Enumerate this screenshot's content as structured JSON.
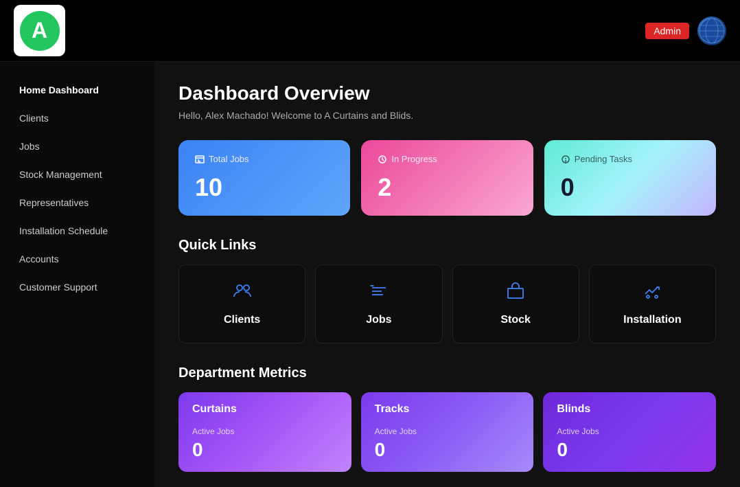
{
  "header": {
    "logo_letter": "A",
    "admin_label": "Admin"
  },
  "sidebar": {
    "items": [
      {
        "id": "home-dashboard",
        "label": "Home Dashboard",
        "active": true
      },
      {
        "id": "clients",
        "label": "Clients",
        "active": false
      },
      {
        "id": "jobs",
        "label": "Jobs",
        "active": false
      },
      {
        "id": "stock-management",
        "label": "Stock Management",
        "active": false
      },
      {
        "id": "representatives",
        "label": "Representatives",
        "active": false
      },
      {
        "id": "installation-schedule",
        "label": "Installation Schedule",
        "active": false
      },
      {
        "id": "accounts",
        "label": "Accounts",
        "active": false
      },
      {
        "id": "customer-support",
        "label": "Customer Support",
        "active": false
      }
    ]
  },
  "content": {
    "page_title": "Dashboard Overview",
    "welcome_message": "Hello, Alex Machado! Welcome to A Curtains and Blids.",
    "stats": [
      {
        "id": "total-jobs",
        "label": "Total Jobs",
        "value": "10",
        "theme": "blue"
      },
      {
        "id": "in-progress",
        "label": "In Progress",
        "value": "2",
        "theme": "pink"
      },
      {
        "id": "pending-tasks",
        "label": "Pending Tasks",
        "value": "0",
        "theme": "teal"
      }
    ],
    "quick_links_title": "Quick Links",
    "quick_links": [
      {
        "id": "clients-link",
        "label": "Clients",
        "icon": "clients"
      },
      {
        "id": "jobs-link",
        "label": "Jobs",
        "icon": "jobs"
      },
      {
        "id": "stock-link",
        "label": "Stock",
        "icon": "stock"
      },
      {
        "id": "installation-link",
        "label": "Installation",
        "icon": "installation"
      }
    ],
    "dept_metrics_title": "Department Metrics",
    "departments": [
      {
        "id": "curtains",
        "label": "Curtains",
        "metric_label": "Active Jobs",
        "metric_value": "0",
        "theme": "curtains"
      },
      {
        "id": "tracks",
        "label": "Tracks",
        "metric_label": "Active Jobs",
        "metric_value": "0",
        "theme": "tracks"
      },
      {
        "id": "blinds",
        "label": "Blinds",
        "metric_label": "Active Jobs",
        "metric_value": "0",
        "theme": "blinds"
      }
    ]
  }
}
